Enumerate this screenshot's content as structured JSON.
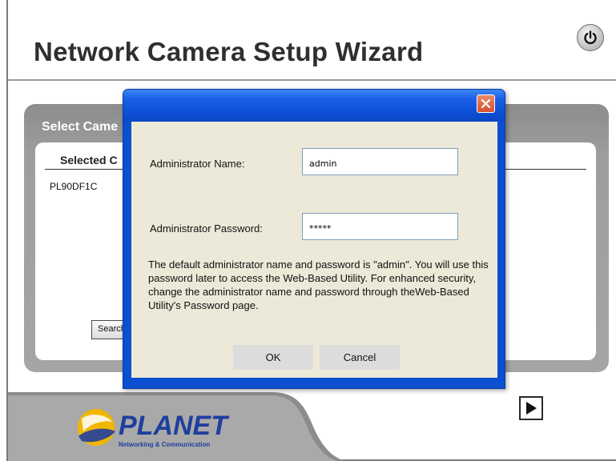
{
  "wizard": {
    "title": "Network Camera Setup Wizard"
  },
  "panel": {
    "heading": "Select Came",
    "column_header": "Selected C",
    "cameras": [
      "PL90DF1C"
    ],
    "search_button_label": "Search A"
  },
  "dialog": {
    "admin_name_label": "Administrator Name:",
    "admin_name_value": "admin",
    "admin_password_label": "Administrator Password:",
    "admin_password_value": "*****",
    "help_text": "The default administrator name and password is \"admin\". You will use this password later to access the Web-Based Utility. For enhanced security, change the administrator name and password through theWeb-Based Utility's Password page.",
    "ok_label": "OK",
    "cancel_label": "Cancel"
  },
  "branding": {
    "logo": "PLANET",
    "tagline": "Networking & Communication"
  },
  "icons": {
    "power": "power-icon",
    "close": "close-icon",
    "next": "play-arrow-icon"
  },
  "colors": {
    "dialog_blue": "#0c4fd0",
    "close_red": "#d6512d",
    "panel_gray": "#a5a5a5",
    "logo_blue": "#1f3f9e"
  }
}
